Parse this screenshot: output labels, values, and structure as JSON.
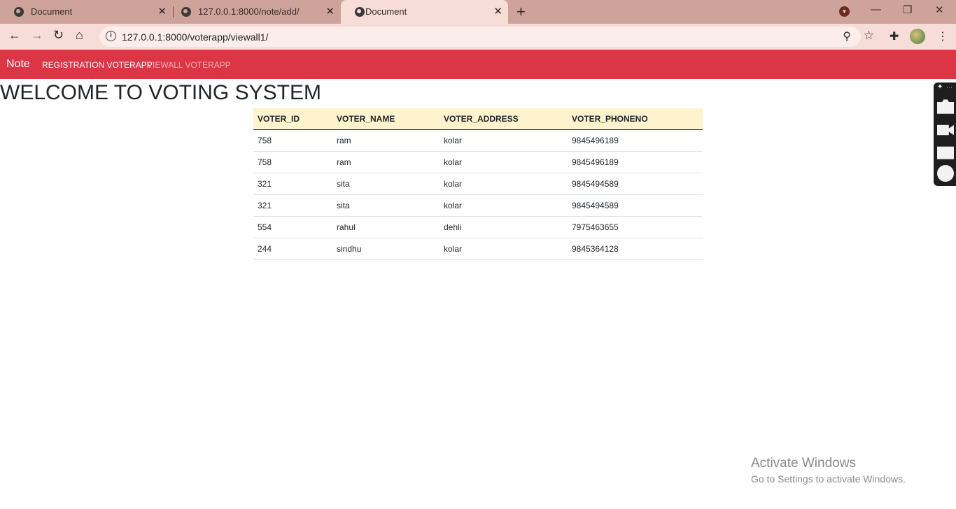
{
  "browser": {
    "tabs": [
      {
        "title": "Document",
        "close": "✕",
        "active": false
      },
      {
        "title": "127.0.0.1:8000/note/add/",
        "close": "✕",
        "active": false
      },
      {
        "title": "Document",
        "close": "✕",
        "active": true
      }
    ],
    "new_tab": "+",
    "url": "127.0.0.1:8000/voterapp/viewall1/",
    "window_controls": {
      "minimize": "—",
      "restore": "❐",
      "close": "✕"
    }
  },
  "navbar": {
    "brand": "Note",
    "links": [
      "REGISTRATION VOTERAPP",
      "VIEWALL VOTERAPP"
    ],
    "color": "#dc3545"
  },
  "page": {
    "heading": "WELCOME TO VOTING SYSTEM"
  },
  "table": {
    "columns": [
      "VOTER_ID",
      "VOTER_NAME",
      "VOTER_ADDRESS",
      "VOTER_PHONENO"
    ],
    "rows": [
      [
        "758",
        "ram",
        "kolar",
        "9845496189"
      ],
      [
        "758",
        "ram",
        "kolar",
        "9845496189"
      ],
      [
        "321",
        "sita",
        "kolar",
        "9845494589"
      ],
      [
        "321",
        "sita",
        "kolar",
        "9845494589"
      ],
      [
        "554",
        "rahul",
        "dehli",
        "7975463655"
      ],
      [
        "244",
        "sindhu",
        "kolar",
        "9845364128"
      ]
    ]
  },
  "side_toolbar": {
    "icons": [
      "pin-icon",
      "camera-icon",
      "video-icon",
      "gallery-icon",
      "gear-icon"
    ]
  },
  "watermark": {
    "line1": "Activate Windows",
    "line2": "Go to Settings to activate Windows."
  }
}
